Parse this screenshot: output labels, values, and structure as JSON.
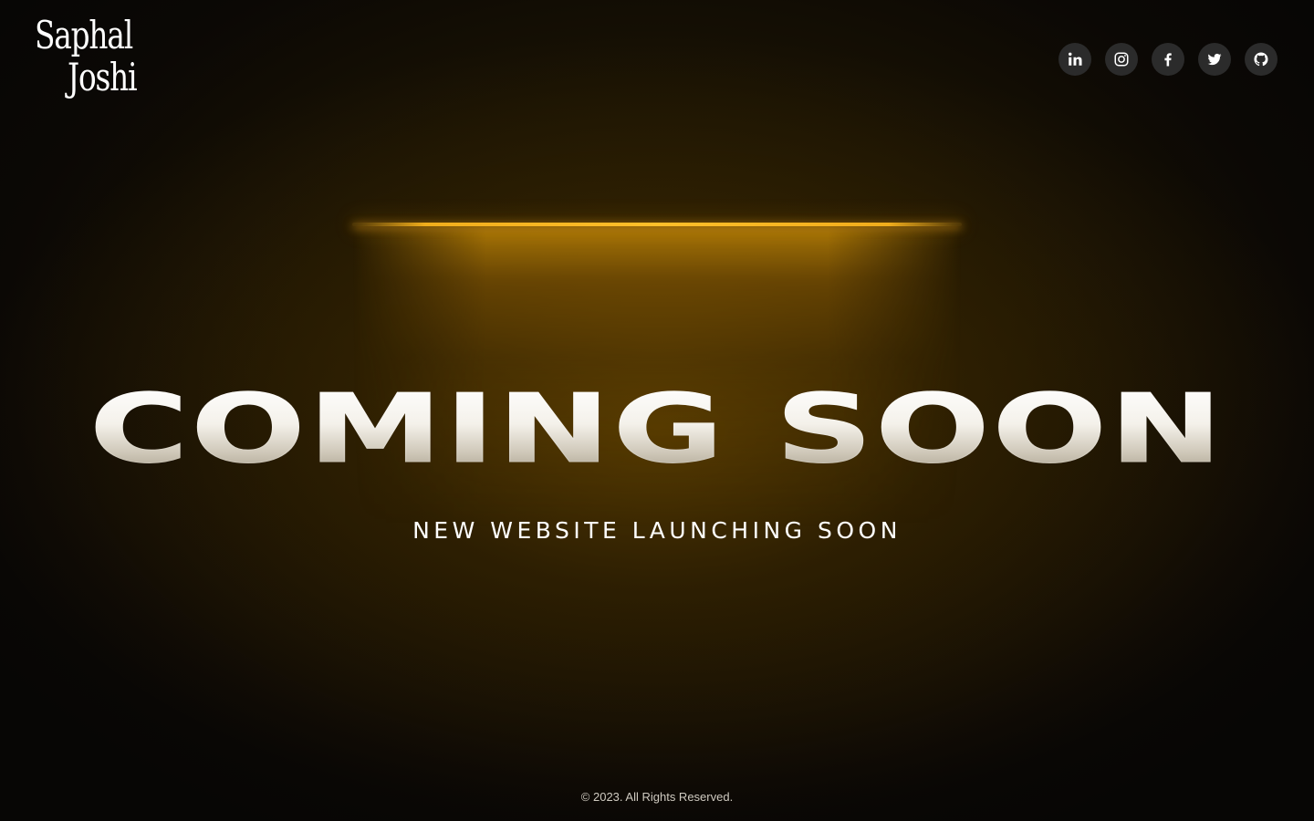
{
  "brand": {
    "logo_line1": "Saphal",
    "logo_line2": "Joshi"
  },
  "socials": [
    {
      "name": "LinkedIn",
      "icon": "linkedin-icon"
    },
    {
      "name": "Instagram",
      "icon": "instagram-icon"
    },
    {
      "name": "Facebook",
      "icon": "facebook-icon"
    },
    {
      "name": "Twitter",
      "icon": "twitter-icon"
    },
    {
      "name": "GitHub",
      "icon": "github-icon"
    }
  ],
  "hero": {
    "headline": "COMING SOON",
    "subheadline": "NEW WEBSITE LAUNCHING SOON"
  },
  "footer": {
    "copyright": "© 2023. All Rights Reserved."
  },
  "colors": {
    "accent_light": "#f0ad1c",
    "icon_bg": "#2b2b2b",
    "background": "#0a0805"
  }
}
